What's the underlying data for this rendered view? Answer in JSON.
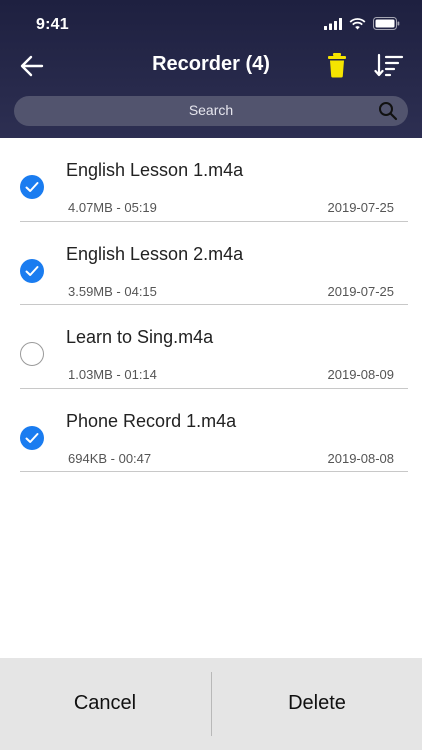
{
  "status": {
    "time": "9:41"
  },
  "nav": {
    "title": "Recorder (4)"
  },
  "search": {
    "placeholder": "Search"
  },
  "files": [
    {
      "name": "English Lesson 1.m4a",
      "meta": "4.07MB - 05:19",
      "date": "2019-07-25",
      "checked": true
    },
    {
      "name": "English Lesson 2.m4a",
      "meta": "3.59MB - 04:15",
      "date": "2019-07-25",
      "checked": true
    },
    {
      "name": "Learn to Sing.m4a",
      "meta": "1.03MB - 01:14",
      "date": "2019-08-09",
      "checked": false
    },
    {
      "name": "Phone Record 1.m4a",
      "meta": "694KB - 00:47",
      "date": "2019-08-08",
      "checked": true
    }
  ],
  "actions": {
    "cancel": "Cancel",
    "delete": "Delete"
  },
  "icons": {
    "back": "back-arrow-icon",
    "trash": "trash-icon",
    "sort": "sort-icon",
    "search": "search-icon",
    "checkmark": "checkmark-icon"
  },
  "colors": {
    "header": "#23254a",
    "accent_blue": "#1a7cf0",
    "trash_yellow": "#f5e400"
  }
}
